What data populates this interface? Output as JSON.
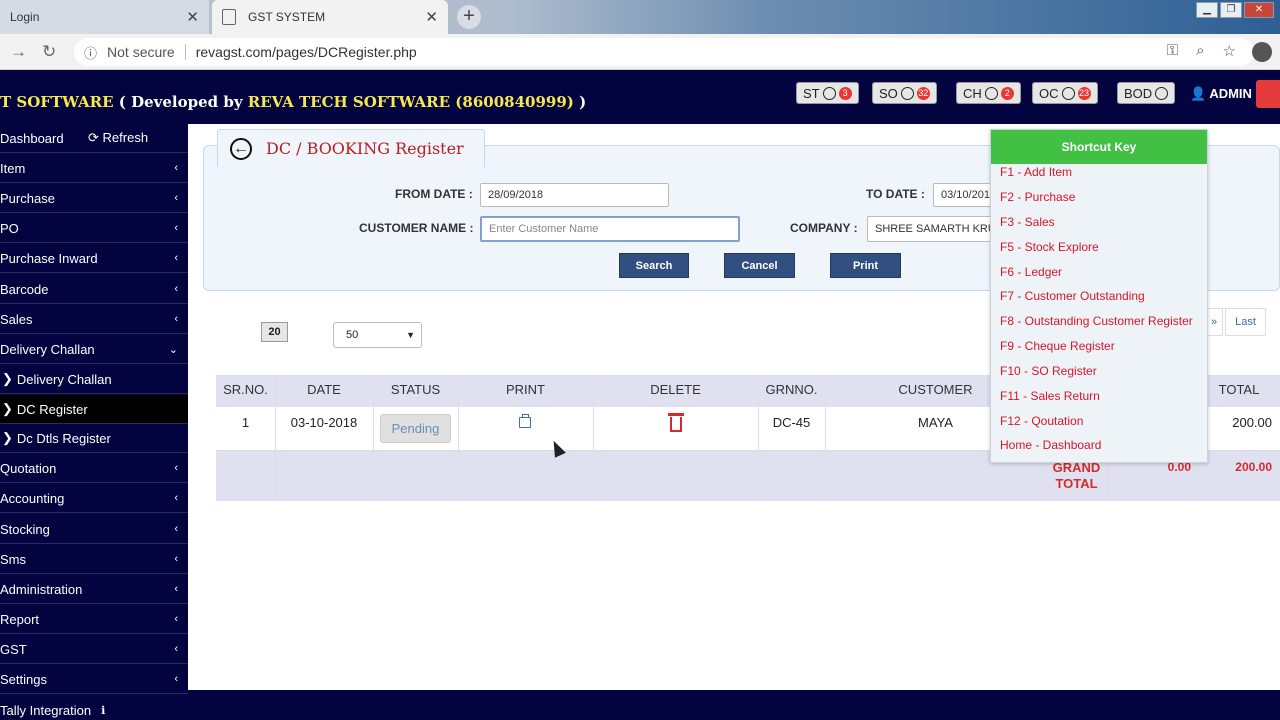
{
  "browser": {
    "tabs": [
      {
        "label": "Login"
      },
      {
        "label": "GST SYSTEM"
      }
    ],
    "security": "Not secure",
    "url": "revagst.com/pages/DCRegister.php"
  },
  "header": {
    "brand_part1": "T SOFTWARE",
    "brand_part2": " ( Developed by ",
    "brand_part3": "REVA TECH SOFTWARE (8600840999)",
    "brand_part4": " )",
    "buttons": [
      {
        "label": "ST",
        "count": "3"
      },
      {
        "label": "SO",
        "count": "32"
      },
      {
        "label": "CH",
        "count": "2"
      },
      {
        "label": "OC",
        "count": "23"
      },
      {
        "label": "BOD",
        "count": ""
      }
    ],
    "user": "ADMIN"
  },
  "sidebar": {
    "dashboard": "Dashboard",
    "refresh": "Refresh",
    "items": [
      {
        "label": "Item"
      },
      {
        "label": "Purchase"
      },
      {
        "label": "PO"
      },
      {
        "label": "Purchase Inward"
      },
      {
        "label": "Barcode"
      },
      {
        "label": "Sales"
      },
      {
        "label": "Delivery Challan"
      },
      {
        "label": "Delivery Challan"
      },
      {
        "label": "DC Register"
      },
      {
        "label": "Dc Dtls Register"
      },
      {
        "label": "Quotation"
      },
      {
        "label": "Accounting"
      },
      {
        "label": "Stocking"
      },
      {
        "label": "Sms"
      },
      {
        "label": "Administration"
      },
      {
        "label": "Report"
      },
      {
        "label": "GST"
      },
      {
        "label": "Settings"
      },
      {
        "label": "Tally Integration"
      }
    ]
  },
  "panel": {
    "title": "DC / BOOKING Register",
    "from_date_label": "FROM DATE :",
    "from_date_value": "28/09/2018",
    "to_date_label": "TO DATE :",
    "to_date_value": "03/10/201",
    "customer_label": "CUSTOMER NAME :",
    "customer_placeholder": "Enter Customer Name",
    "company_label": "COMPANY :",
    "company_value": "SHREE SAMARTH KRU",
    "search": "Search",
    "cancel": "Cancel",
    "print": "Print"
  },
  "paging": {
    "page_size_badge": "20",
    "page_size_select": "50",
    "next": "»",
    "last": "Last"
  },
  "table": {
    "headers": [
      "SR.NO.",
      "DATE",
      "STATUS",
      "PRINT",
      "DELETE",
      "GRNNO.",
      "CUSTOMER",
      "TOTAL"
    ],
    "rows": [
      {
        "srno": "1",
        "date": "03-10-2018",
        "status": "Pending",
        "grnno": "DC-45",
        "customer": "MAYA",
        "total": "200.00"
      }
    ],
    "grand_label": "GRAND TOTAL",
    "grand_mid": "0.00",
    "grand_total": "200.00"
  },
  "shortcuts": {
    "title": "Shortcut Key",
    "items": [
      "F1 - Add Item",
      "F2 - Purchase",
      "F3 - Sales",
      "F5 - Stock Explore",
      "F6 - Ledger",
      "F7 - Customer Outstanding",
      "F8 - Outstanding Customer Register",
      "F9 - Cheque Register",
      "F10 - SO Register",
      "F11 - Sales Return",
      "F12 - Qoutation",
      "Home - Dashboard"
    ]
  }
}
